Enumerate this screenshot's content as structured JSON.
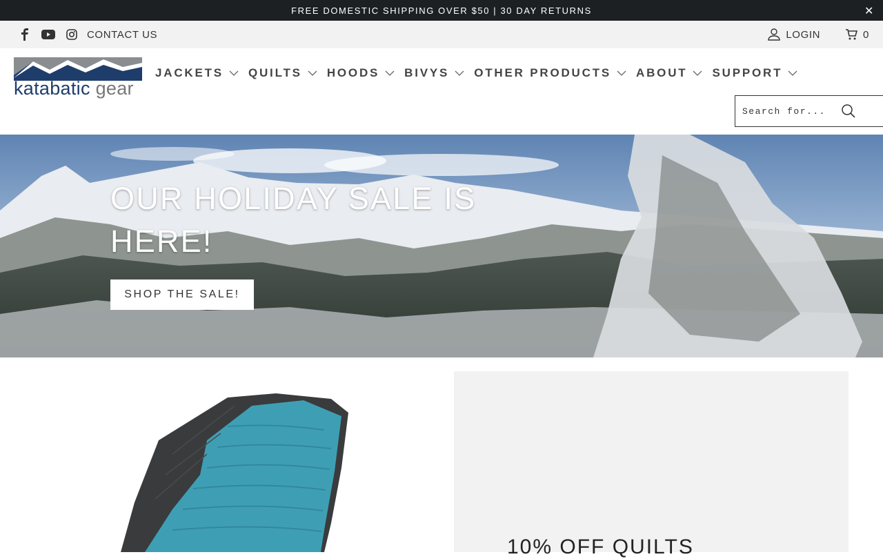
{
  "announcement": {
    "text": "FREE DOMESTIC SHIPPING OVER $50 | 30 DAY RETURNS",
    "close_icon": "close-icon"
  },
  "utility_bar": {
    "social_icons": [
      "facebook-icon",
      "youtube-icon",
      "instagram-icon"
    ],
    "contact_label": "CONTACT US",
    "login_label": "LOGIN",
    "cart_count": "0"
  },
  "header": {
    "logo": {
      "word_primary": "katabatic",
      "word_secondary": "gear"
    },
    "nav": [
      {
        "label": "JACKETS"
      },
      {
        "label": "QUILTS"
      },
      {
        "label": "HOODS"
      },
      {
        "label": "BIVYS"
      },
      {
        "label": "OTHER PRODUCTS"
      },
      {
        "label": "ABOUT"
      },
      {
        "label": "SUPPORT"
      }
    ],
    "search": {
      "placeholder": "Search for..."
    }
  },
  "hero": {
    "headline": "OUR HOLIDAY SALE IS HERE!",
    "cta_label": "SHOP THE SALE!"
  },
  "promo": {
    "right_title": "10% OFF QUILTS"
  },
  "colors": {
    "announcement_bg": "#1d2022",
    "utility_bg": "#f2f2f2",
    "logo_navy": "#1e3d6b",
    "quilt_blue": "#3e9fb4",
    "quilt_shell": "#3a3b3d"
  }
}
